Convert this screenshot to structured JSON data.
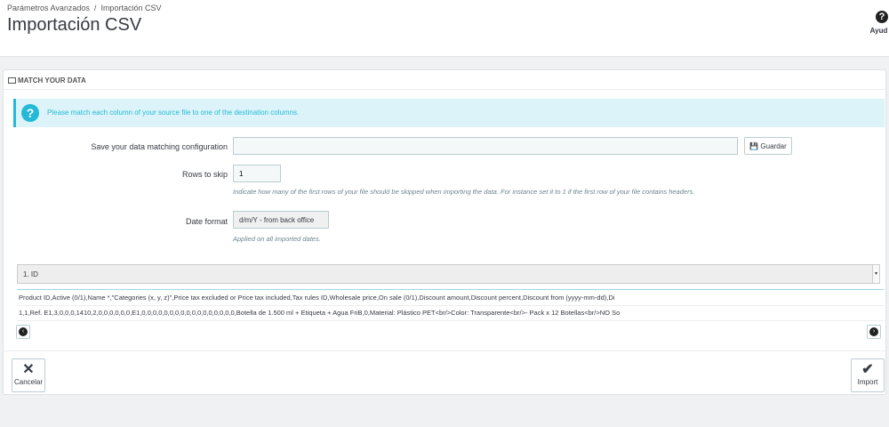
{
  "breadcrumb": [
    "Parámetros Avanzados",
    "Importación CSV"
  ],
  "breadcrumb_sep": "/",
  "title": "Importación CSV",
  "help_label": "Ayud",
  "panel": {
    "heading": "MATCH YOUR DATA",
    "alert": "Please match each column of your source file to one of the destination columns.",
    "save_config_label": "Save your data matching configuration",
    "save_config_value": "",
    "save_button": "Guardar",
    "rows_to_skip_label": "Rows to skip",
    "rows_to_skip_value": "1",
    "rows_to_skip_hint": "Indicate how many of the first rows of your file should be skipped when importing the data. For instance set it to 1 if the first row of your file contains headers.",
    "date_format_label": "Date format",
    "date_format_value": "d/m/Y - from back office",
    "date_format_hint": "Applied on all imported dates.",
    "column_select": "1. ID",
    "rows": [
      "Product ID,Active (0/1),Name *,\"Categories (x, y, z)\",Price tax excluded or Price tax included,Tax rules ID,Wholesale price,On sale (0/1),Discount amount,Discount percent,Discount from (yyyy-mm-dd),Di",
      "1,1,Ref. E1,3,0,0,0,1410,2,0,0,0,0,0,0,E1,0,0,0,0,0,0,0,0,0,0,0,0,0,0,0,0,0,Botella de 1.500 ml + Etiqueta + Agua FriB,0,Material: Plástico PET<br/>Color: Transparente<br/>- Pack x 12 Botellas<br/>NO So"
    ],
    "cancel": "Cancelar",
    "import": "Import"
  }
}
